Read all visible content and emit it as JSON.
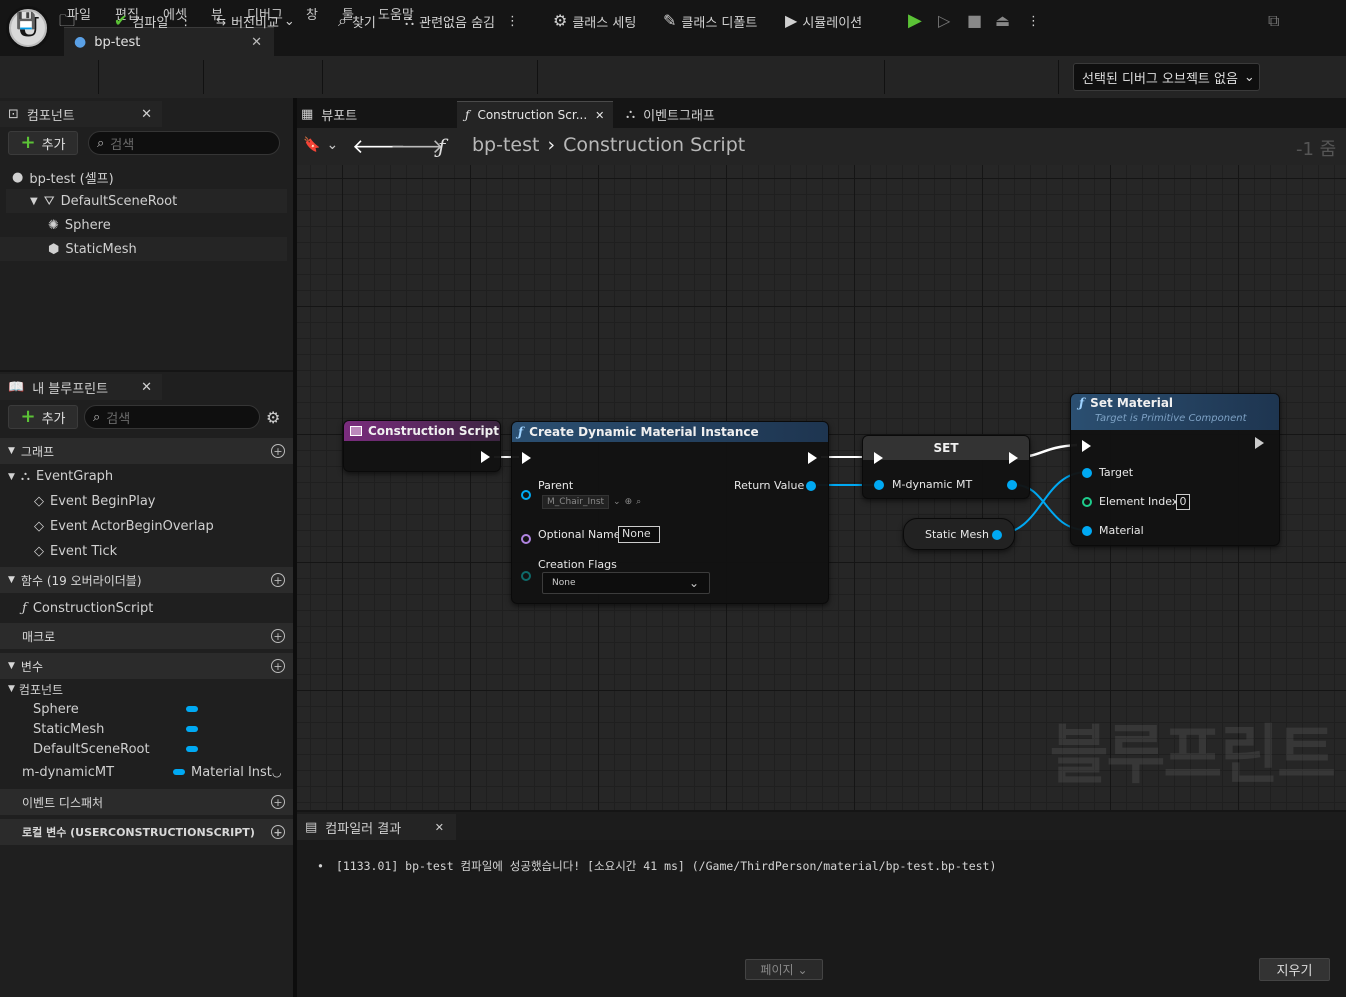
{
  "menu": [
    "파일",
    "편집",
    "에셋",
    "뷰",
    "디버그",
    "창",
    "툴",
    "도움말"
  ],
  "doc_tab": {
    "title": "bp-test"
  },
  "toolbar": {
    "compile": "컴파일",
    "diff": "버전비교",
    "find": "찾기",
    "hide_unrelated": "관련없음 숨김",
    "class_settings": "클래스 세팅",
    "class_defaults": "클래스 디폴트",
    "simulation": "시뮬레이션",
    "debug_select": "선택된 디버그 오브젝트 없음"
  },
  "components": {
    "tab": "컴포넌트",
    "add": "추가",
    "search_placeholder": "검색",
    "root": "bp-test (셀프)",
    "items": [
      "DefaultSceneRoot",
      "Sphere",
      "StaticMesh"
    ]
  },
  "my_blueprint": {
    "tab": "내 블루프린트",
    "add": "추가",
    "search_placeholder": "검색",
    "graphs_header": "그래프",
    "event_graph": "EventGraph",
    "events": [
      "Event BeginPlay",
      "Event ActorBeginOverlap",
      "Event Tick"
    ],
    "functions_header": "함수 (19 오버라이더블)",
    "construction_script": "ConstructionScript",
    "macros_header": "매크로",
    "variables_header": "변수",
    "components_header": "컴포넌트",
    "component_vars": [
      "Sphere",
      "StaticMesh",
      "DefaultSceneRoot"
    ],
    "var_name": "m-dynamicMT",
    "var_type": "Material Inst",
    "dispatchers_header": "이벤트 디스패처",
    "local_vars_header": "로컬 변수 (USERCONSTRUCTIONSCRIPT)"
  },
  "graph_tabs": {
    "viewport": "뷰포트",
    "construction": "Construction Scr...",
    "event_graph": "이벤트그래프"
  },
  "breadcrumb": {
    "root": "bp-test",
    "current": "Construction Script",
    "zoom": "-1 줌"
  },
  "nodes": {
    "construction_script": {
      "title": "Construction Script"
    },
    "create_dmi": {
      "title": "Create Dynamic Material Instance",
      "parent": "Parent",
      "parent_value": "M_Chair_Inst",
      "optional_name": "Optional Name",
      "optional_name_value": "None",
      "creation_flags": "Creation Flags",
      "creation_flags_value": "None",
      "return_value": "Return Value"
    },
    "set": {
      "title": "SET",
      "var": "M-dynamic MT"
    },
    "static_mesh": {
      "label": "Static Mesh"
    },
    "set_material": {
      "title": "Set Material",
      "subtitle": "Target is Primitive Component",
      "target": "Target",
      "element_index": "Element Index",
      "element_index_value": "0",
      "material": "Material"
    }
  },
  "watermark": "블루프린트",
  "compiler": {
    "tab": "컴파일러 결과",
    "message": "[1133.01] bp-test 컴파일에 성공했습니다! [소요시간 41 ms] (/Game/ThirdPerson/material/bp-test.bp-test)",
    "page": "페이지",
    "clear": "지우기"
  },
  "colors": {
    "accent_blue": "#00a9f3",
    "pure_header": "#2b4f71",
    "event_header": "#7a2c7e",
    "compile_green": "#5bc236"
  }
}
